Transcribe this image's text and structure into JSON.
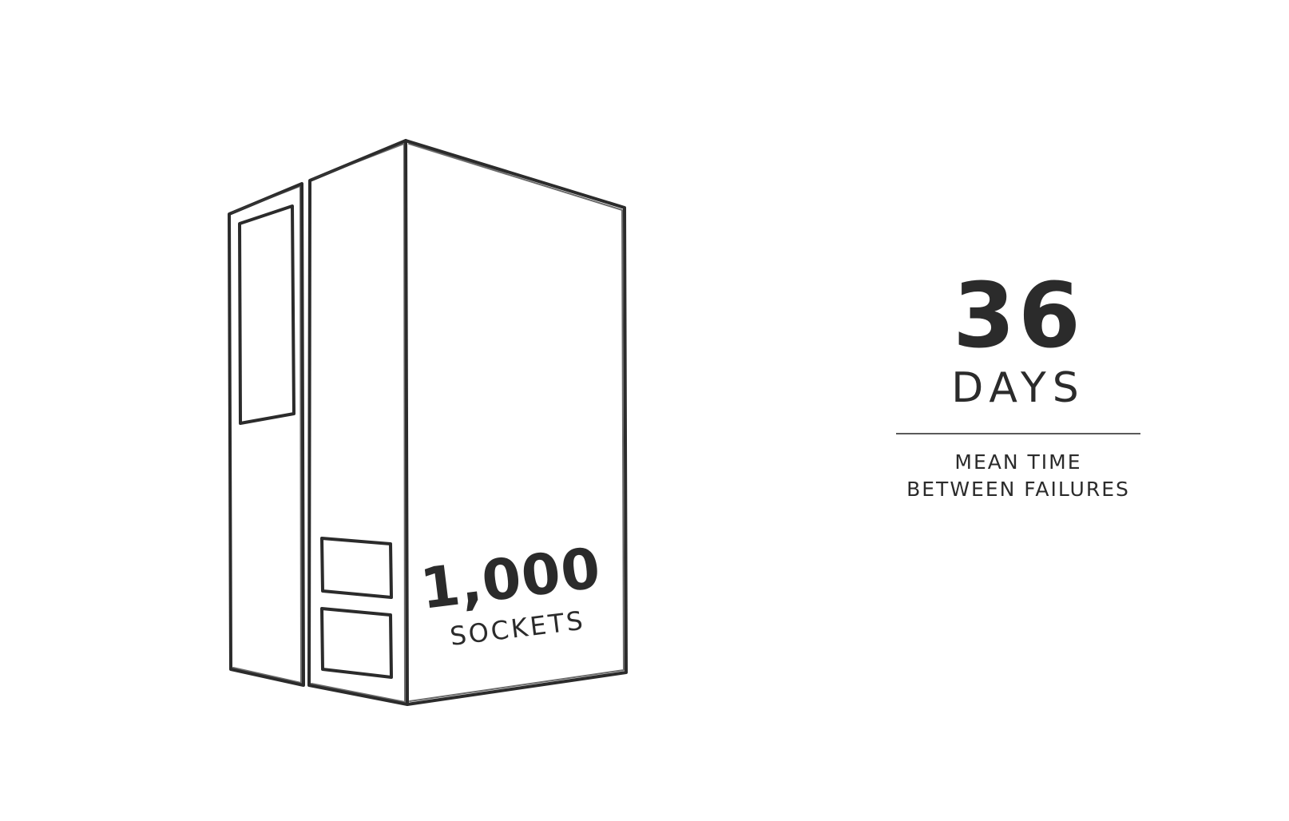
{
  "illustration": {
    "icon": "server-cabinet-icon",
    "socket_count": "1,000",
    "socket_label": "SOCKETS"
  },
  "stat": {
    "value": "36",
    "unit": "DAYS",
    "caption_line1": "MEAN TIME",
    "caption_line2": "BETWEEN FAILURES"
  },
  "colors": {
    "background": "#ffffff",
    "ink": "#2b2b2b"
  }
}
